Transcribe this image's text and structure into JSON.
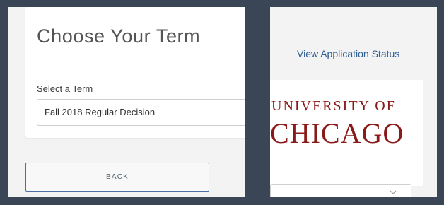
{
  "term_form": {
    "title": "Choose Your Term",
    "select_label": "Select a Term",
    "select_value": "Fall 2018 Regular Decision",
    "back_label": "BACK"
  },
  "side": {
    "status_link": "View Application Status",
    "logo_line1": "UNIVERSITY OF",
    "logo_line2": "CHICAGO",
    "logo_color": "#8a1a1a"
  },
  "colors": {
    "frame": "#3a4556",
    "link": "#2e5e93",
    "button_border": "#4a6fa5"
  }
}
